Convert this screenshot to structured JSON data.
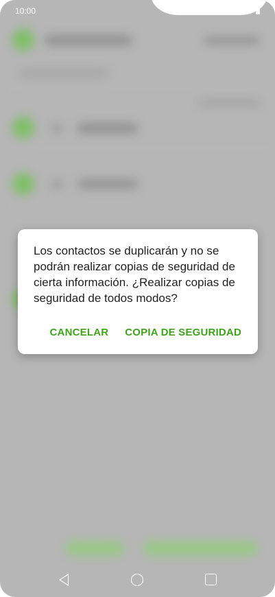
{
  "status_bar": {
    "time": "10:00",
    "battery": "100%"
  },
  "dialog": {
    "message": "Los contactos se duplicarán y no se podrán realizar copias de seguridad de cierta información. ¿Realizar copias de seguridad de todos modos?",
    "cancel_label": "CANCELAR",
    "confirm_label": "COPIA DE SEGURIDAD",
    "accent_color": "#3ea51a"
  },
  "nav_bar": {
    "back_icon": "back-icon",
    "home_icon": "home-icon",
    "recent_icon": "recent-apps-icon"
  }
}
